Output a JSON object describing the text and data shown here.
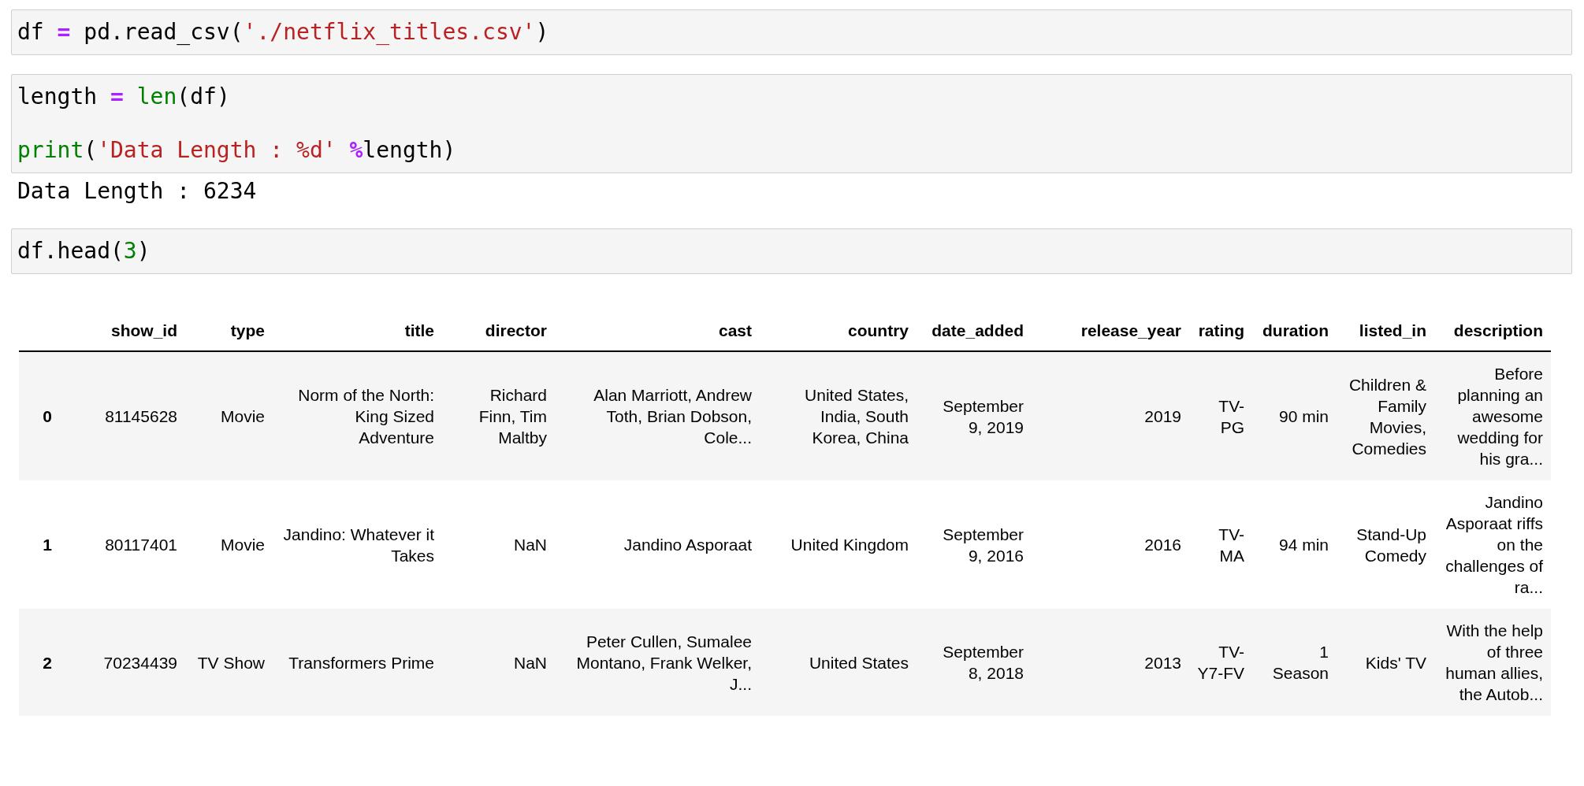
{
  "cells": [
    {
      "kind": "code",
      "lines": [
        {
          "tokens": [
            {
              "kind": "text",
              "t": "df "
            },
            {
              "kind": "op",
              "t": "="
            },
            {
              "kind": "text",
              "t": " pd.read_csv("
            },
            {
              "kind": "string",
              "t": "'./netflix_titles.csv'"
            },
            {
              "kind": "text",
              "t": ")"
            }
          ]
        }
      ]
    },
    {
      "kind": "code",
      "lines": [
        {
          "blank_before": false,
          "tokens": [
            {
              "kind": "text",
              "t": "length "
            },
            {
              "kind": "op",
              "t": "= "
            },
            {
              "kind": "builtin",
              "t": "len"
            },
            {
              "kind": "text",
              "t": "(df)"
            }
          ]
        },
        {
          "blank_before": true,
          "tokens": [
            {
              "kind": "builtin",
              "t": "print"
            },
            {
              "kind": "text",
              "t": "("
            },
            {
              "kind": "string",
              "t": "'Data Length : %d' "
            },
            {
              "kind": "op",
              "t": "%"
            },
            {
              "kind": "text",
              "t": "length)"
            }
          ]
        }
      ]
    },
    {
      "kind": "output",
      "text": "Data Length : 6234"
    },
    {
      "kind": "code",
      "lines": [
        {
          "tokens": [
            {
              "kind": "text",
              "t": "df.head("
            },
            {
              "kind": "number",
              "t": "3"
            },
            {
              "kind": "text",
              "t": ")"
            }
          ]
        }
      ]
    },
    {
      "kind": "table",
      "columns": [
        "show_id",
        "type",
        "title",
        "director",
        "cast",
        "country",
        "date_added",
        "release_year",
        "rating",
        "duration",
        "listed_in",
        "description"
      ],
      "rows": [
        {
          "index": "0",
          "cells": [
            "81145628",
            "Movie",
            "Norm of the North: King Sized Adventure",
            "Richard Finn, Tim Maltby",
            "Alan Marriott, Andrew Toth, Brian Dobson, Cole...",
            "United States, India, South Korea, China",
            "September 9, 2019",
            "2019",
            "TV-PG",
            "90 min",
            "Children & Family Movies, Comedies",
            "Before planning an awesome wedding for his gra..."
          ]
        },
        {
          "index": "1",
          "cells": [
            "80117401",
            "Movie",
            "Jandino: Whatever it Takes",
            "NaN",
            "Jandino Asporaat",
            "United Kingdom",
            "September 9, 2016",
            "2016",
            "TV-MA",
            "94 min",
            "Stand-Up Comedy",
            "Jandino Asporaat riffs on the challenges of ra..."
          ]
        },
        {
          "index": "2",
          "cells": [
            "70234439",
            "TV Show",
            "Transformers Prime",
            "NaN",
            "Peter Cullen, Sumalee Montano, Frank Welker, J...",
            "United States",
            "September 8, 2018",
            "2013",
            "TV-Y7-FV",
            "1 Season",
            "Kids' TV",
            "With the help of three human allies, the Autob..."
          ]
        }
      ]
    }
  ]
}
